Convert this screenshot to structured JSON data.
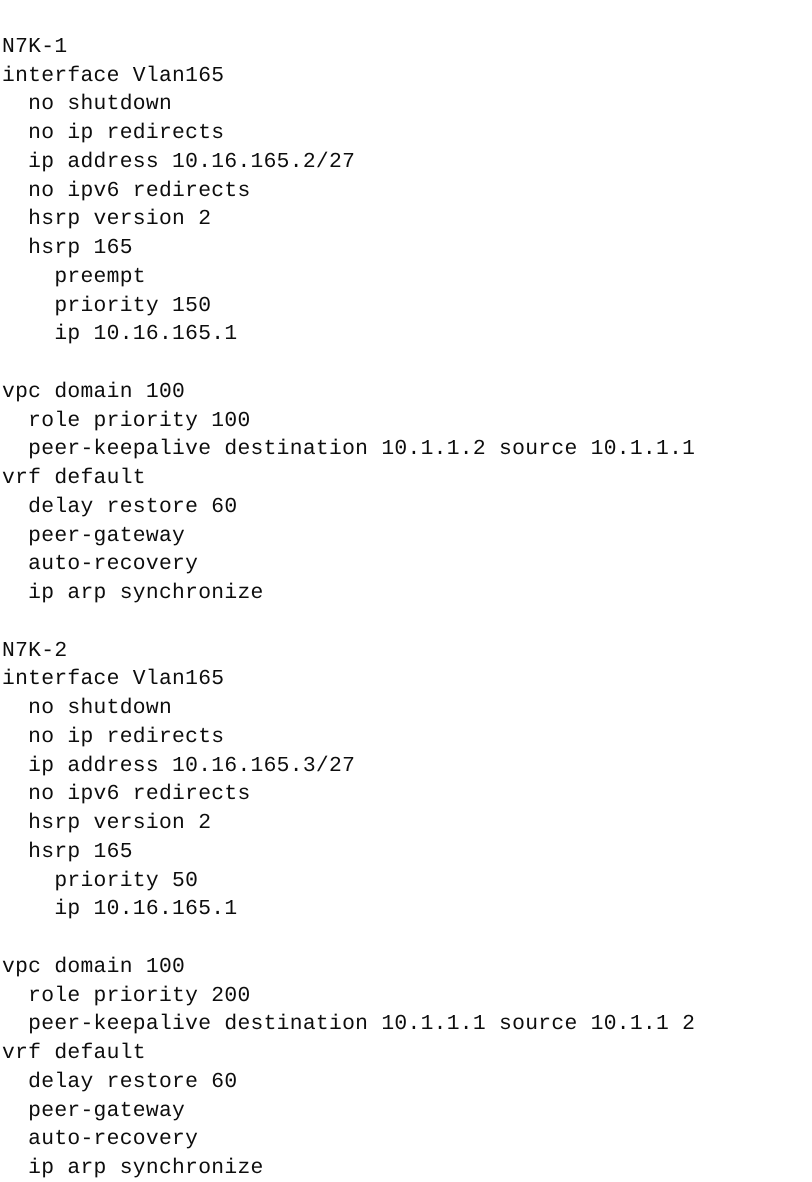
{
  "document": {
    "kind": "text-listing",
    "background_color": "#ffffff",
    "text_color": "#0d0d0d",
    "font_style": "monospace-typewriter",
    "total_lines": 39
  },
  "listing": {
    "lines": [
      "N7K-1",
      "interface Vlan165",
      "  no shutdown",
      "  no ip redirects",
      "  ip address 10.16.165.2/27",
      "  no ipv6 redirects",
      "  hsrp version 2",
      "  hsrp 165",
      "    preempt",
      "    priority 150",
      "    ip 10.16.165.1",
      "",
      "vpc domain 100",
      "  role priority 100",
      "  peer-keepalive destination 10.1.1.2 source 10.1.1.1",
      "vrf default",
      "  delay restore 60",
      "  peer-gateway",
      "  auto-recovery",
      "  ip arp synchronize",
      "",
      "N7K-2",
      "interface Vlan165",
      "  no shutdown",
      "  no ip redirects",
      "  ip address 10.16.165.3/27",
      "  no ipv6 redirects",
      "  hsrp version 2",
      "  hsrp 165",
      "    priority 50",
      "    ip 10.16.165.1",
      "",
      "vpc domain 100",
      "  role priority 200",
      "  peer-keepalive destination 10.1.1.1 source 10.1.1 2",
      "vrf default",
      "  delay restore 60",
      "  peer-gateway",
      "  auto-recovery",
      "  ip arp synchronize"
    ]
  },
  "devices": [
    {
      "name": "N7K-1",
      "interface": {
        "name": "interface Vlan165",
        "commands": [
          "no shutdown",
          "no ip redirects",
          "ip address 10.16.165.2/27",
          "no ipv6 redirects",
          "hsrp version 2",
          "hsrp 165"
        ],
        "hsrp_group": "165",
        "hsrp_version": "2",
        "ip_address": "10.16.165.2/27",
        "hsrp_commands": [
          "preempt",
          "priority 150",
          "ip 10.16.165.1"
        ],
        "hsrp_priority": "150",
        "hsrp_virtual_ip": "10.16.165.1",
        "preempt": "preempt"
      },
      "vpc": {
        "domain": "vpc domain 100",
        "domain_id": "100",
        "role_priority": "role priority 100",
        "role_priority_value": "100",
        "peer_keepalive": "peer-keepalive destination 10.1.1.2 source 10.1.1.1",
        "peer_keepalive_destination": "10.1.1.2",
        "peer_keepalive_source": "10.1.1.1",
        "vrf": "vrf default",
        "commands": [
          "delay restore 60",
          "peer-gateway",
          "auto-recovery",
          "ip arp synchronize"
        ]
      }
    },
    {
      "name": "N7K-2",
      "interface": {
        "name": "interface Vlan165",
        "commands": [
          "no shutdown",
          "no ip redirects",
          "ip address 10.16.165.3/27",
          "no ipv6 redirects",
          "hsrp version 2",
          "hsrp 165"
        ],
        "hsrp_group": "165",
        "hsrp_version": "2",
        "ip_address": "10.16.165.3/27",
        "hsrp_commands": [
          "priority 50",
          "ip 10.16.165.1"
        ],
        "hsrp_priority": "50",
        "hsrp_virtual_ip": "10.16.165.1",
        "preempt": ""
      },
      "vpc": {
        "domain": "vpc domain 100",
        "domain_id": "100",
        "role_priority": "role priority 200",
        "role_priority_value": "200",
        "peer_keepalive": "peer-keepalive destination 10.1.1.1 source 10.1.1 2",
        "peer_keepalive_destination": "10.1.1.1",
        "peer_keepalive_source": "10.1.1 2",
        "vrf": "vrf default",
        "commands": [
          "delay restore 60",
          "peer-gateway",
          "auto-recovery",
          "ip arp synchronize"
        ]
      }
    }
  ]
}
